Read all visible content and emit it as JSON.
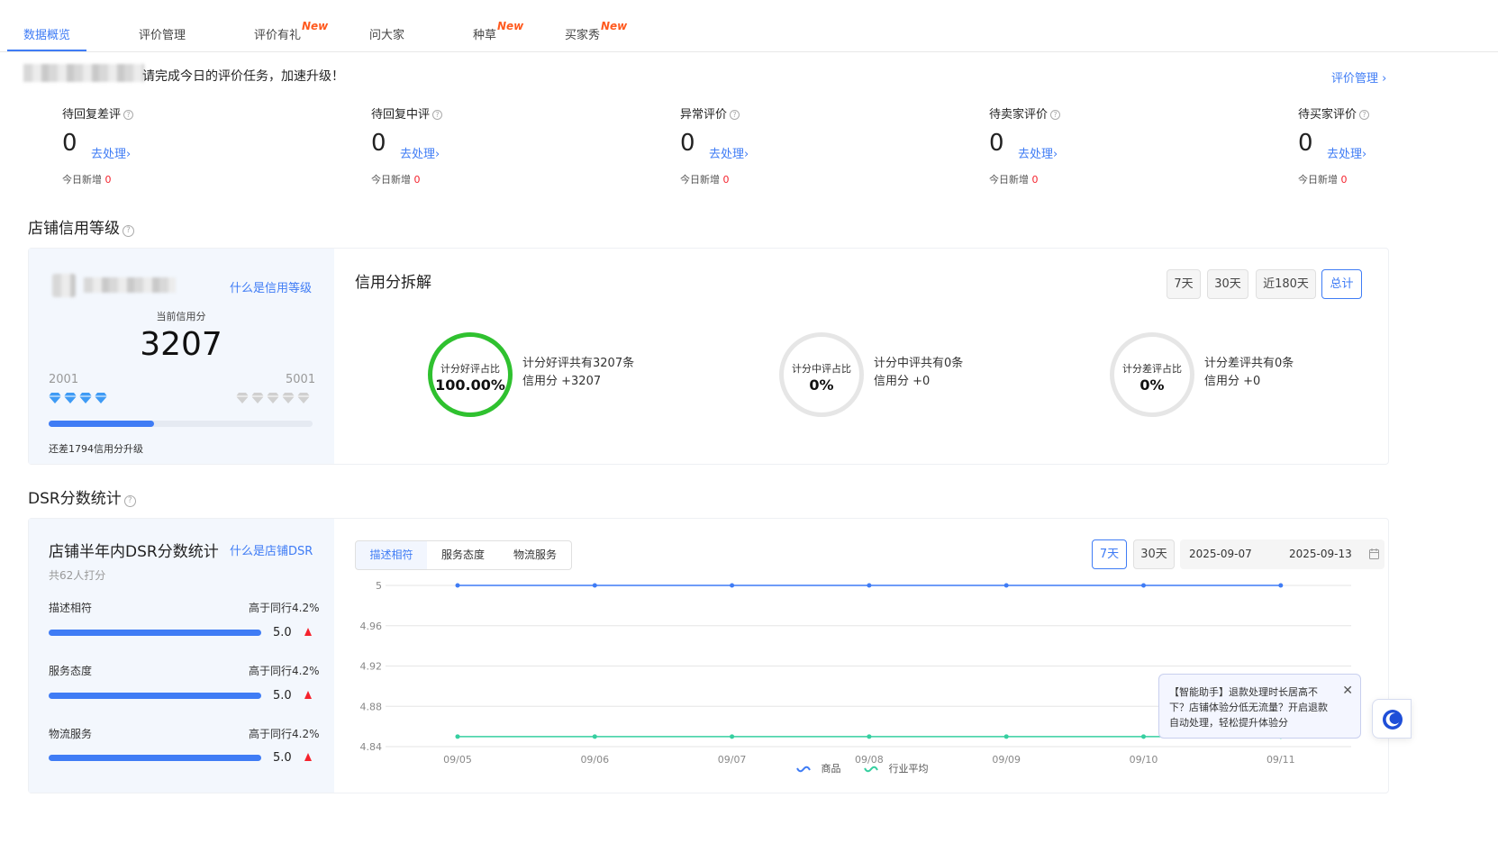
{
  "tabs": [
    {
      "label": "数据概览",
      "active": true
    },
    {
      "label": "评价管理"
    },
    {
      "label": "评价有礼",
      "badge": "New"
    },
    {
      "label": "问大家"
    },
    {
      "label": "种草",
      "badge": "New"
    },
    {
      "label": "买家秀",
      "badge": "New"
    }
  ],
  "notice": "请完成今日的评价任务，加速升级！",
  "review_manage_link": "评价管理 ›",
  "stats": [
    {
      "title": "待回复差评",
      "value": "0",
      "action": "去处理›",
      "today_label": "今日新增",
      "today_value": "0"
    },
    {
      "title": "待回复中评",
      "value": "0",
      "action": "去处理›",
      "today_label": "今日新增",
      "today_value": "0"
    },
    {
      "title": "异常评价",
      "value": "0",
      "action": "去处理›",
      "today_label": "今日新增",
      "today_value": "0"
    },
    {
      "title": "待卖家评价",
      "value": "0",
      "action": "去处理›",
      "today_label": "今日新增",
      "today_value": "0"
    },
    {
      "title": "待买家评价",
      "value": "0",
      "action": "去处理›",
      "today_label": "今日新增",
      "today_value": "0"
    }
  ],
  "credit": {
    "section_title": "店铺信用等级",
    "what_link": "什么是信用等级",
    "current_label": "当前信用分",
    "score": "3207",
    "low": "2001",
    "high": "5001",
    "progress": 0.4,
    "upgrade_text": "还差1794信用分升级",
    "breakdown_title": "信用分拆解",
    "ranges": [
      "7天",
      "30天",
      "近180天",
      "总计"
    ],
    "active_range": "总计",
    "rings": [
      {
        "label": "计分好评占比",
        "value": "100.00%",
        "line1": "计分好评共有3207条",
        "line2": "信用分 +3207",
        "color": "#2fc12f",
        "ratio": 1.0
      },
      {
        "label": "计分中评占比",
        "value": "0%",
        "line1": "计分中评共有0条",
        "line2": "信用分 +0",
        "color": "#e6e6e6",
        "ratio": 0
      },
      {
        "label": "计分差评占比",
        "value": "0%",
        "line1": "计分差评共有0条",
        "line2": "信用分 +0",
        "color": "#e6e6e6",
        "ratio": 0
      }
    ]
  },
  "dsr": {
    "section_title": "DSR分数统计",
    "card_title": "店铺半年内DSR分数统计",
    "what_link": "什么是店铺DSR",
    "raters": "共62人打分",
    "rows": [
      {
        "label": "描述相符",
        "compare": "高于同行4.2%",
        "score": "5.0"
      },
      {
        "label": "服务态度",
        "compare": "高于同行4.2%",
        "score": "5.0"
      },
      {
        "label": "物流服务",
        "compare": "高于同行4.2%",
        "score": "5.0"
      }
    ],
    "segments": [
      "描述相符",
      "服务态度",
      "物流服务"
    ],
    "active_segment": "描述相符",
    "ranges": [
      "7天",
      "30天"
    ],
    "active_range": "7天",
    "date_start": "2025-09-07",
    "date_end": "2025-09-13"
  },
  "chart_data": {
    "type": "line",
    "x": [
      "09/05",
      "09/06",
      "09/07",
      "09/08",
      "09/09",
      "09/10",
      "09/11"
    ],
    "ylim": [
      4.84,
      5
    ],
    "yticks": [
      "5",
      "4.96",
      "4.92",
      "4.88",
      "4.84"
    ],
    "series": [
      {
        "name": "商品",
        "color": "#3f7cf5",
        "values": [
          5,
          5,
          5,
          5,
          5,
          5,
          5
        ]
      },
      {
        "name": "行业平均",
        "color": "#36cfa0",
        "values": [
          4.85,
          4.85,
          4.85,
          4.85,
          4.85,
          4.85,
          4.85
        ]
      }
    ],
    "legend": "bottom",
    "grid": true
  },
  "assistant_tip": "【智能助手】退款处理时长居高不下？店铺体验分低无流量？开启退款自动处理，轻松提升体验分",
  "colors": {
    "accent": "#3f7cf5",
    "good": "#2fc12f",
    "alert": "#f5222d"
  }
}
